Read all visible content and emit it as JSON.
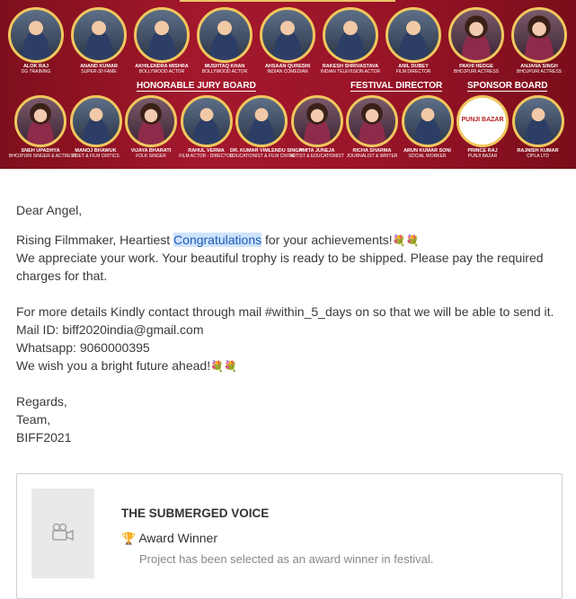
{
  "banner": {
    "row1": [
      {
        "name": "ALOK RAJ",
        "sub": "DG TRAINING",
        "female": false
      },
      {
        "name": "ANAND KUMAR",
        "sub": "SUPER-30 FAME",
        "female": false
      },
      {
        "name": "AKHILENDRA MISHRA",
        "sub": "BOLLYWOOD ACTOR",
        "female": false
      },
      {
        "name": "MUSHTAQ KHAN",
        "sub": "BOLLYWOOD ACTOR",
        "female": false
      },
      {
        "name": "AHSAAN QURESHI",
        "sub": "INDIAN COMEDIAN",
        "female": false
      },
      {
        "name": "RAKESH SHRIVASTAVA",
        "sub": "INDIAN TELEVISION ACTOR",
        "female": false
      },
      {
        "name": "ANIL DUBEY",
        "sub": "FILM DIRECTOR",
        "female": false
      },
      {
        "name": "PAKHI HEDGE",
        "sub": "BHOJPURI ACTRESS",
        "female": true
      },
      {
        "name": "ANJANA SINGH",
        "sub": "BHOJPURI ACTRESS",
        "female": true
      }
    ],
    "row2": [
      {
        "name": "SNEH UPADHYA",
        "sub": "BHOJPURI SINGER & ACTRESS",
        "female": true
      },
      {
        "name": "MANOJ BHAWUK",
        "sub": "POET & FILM CRITICS",
        "female": false
      },
      {
        "name": "VIJAYA BHARATI",
        "sub": "FOLK SINGER",
        "female": true
      },
      {
        "name": "RAHUL VERMA",
        "sub": "FILM ACTOR - DIRECTOR",
        "female": false
      },
      {
        "name": "DR. KUMAR VIMLENDU SINGH",
        "sub": "EDUCATIONIST & FILM CRITIC",
        "female": false
      },
      {
        "name": "AMITA JUNEJA",
        "sub": "ARTIST & EDUCATIONIST",
        "female": true
      },
      {
        "name": "RICHA SHARMA",
        "sub": "JOURNALIST & WRITER",
        "female": true
      },
      {
        "name": "ARUN KUMAR SONI",
        "sub": "SOCIAL WORKER",
        "female": false
      },
      {
        "name": "PRINCE RAJ",
        "sub": "PUNJI BAZAR",
        "female": false,
        "logo": "PUNJI BAZAR"
      },
      {
        "name": "RAJNISH KUMAR",
        "sub": "CIPLA LTD",
        "female": false
      }
    ],
    "boards": {
      "jury": "HONORABLE JURY BOARD",
      "festival": "FESTIVAL DIRECTOR",
      "sponsor": "SPONSOR BOARD"
    }
  },
  "email": {
    "greeting": "Dear Angel,",
    "line1_pre": "Rising Filmmaker, Heartiest ",
    "line1_highlight": "Congratulations",
    "line1_post": " for your achievements!",
    "flowers": "💐💐",
    "line2": "We appreciate your work. Your beautiful trophy is ready to be shipped. Please pay the required charges for that.",
    "line3": "For more details Kindly contact through mail #within_5_days on so that we will be able to send it.",
    "mail_id": "Mail ID: biff2020india@gmail.com",
    "whatsapp": "Whatsapp: 9060000395",
    "wish": "We wish you a bright future ahead!",
    "regards": "Regards,",
    "team": "Team,",
    "org": "BIFF2021"
  },
  "card": {
    "title": "THE SUBMERGED VOICE",
    "award_label": "Award Winner",
    "award_desc": "Project has been selected as an award winner in festival.",
    "thumb_icon": "video-camera-icon"
  },
  "colors": {
    "banner_red": "#9a1428",
    "ring_gold": "#f0c75e",
    "highlight_bg": "#cfe3fb"
  }
}
